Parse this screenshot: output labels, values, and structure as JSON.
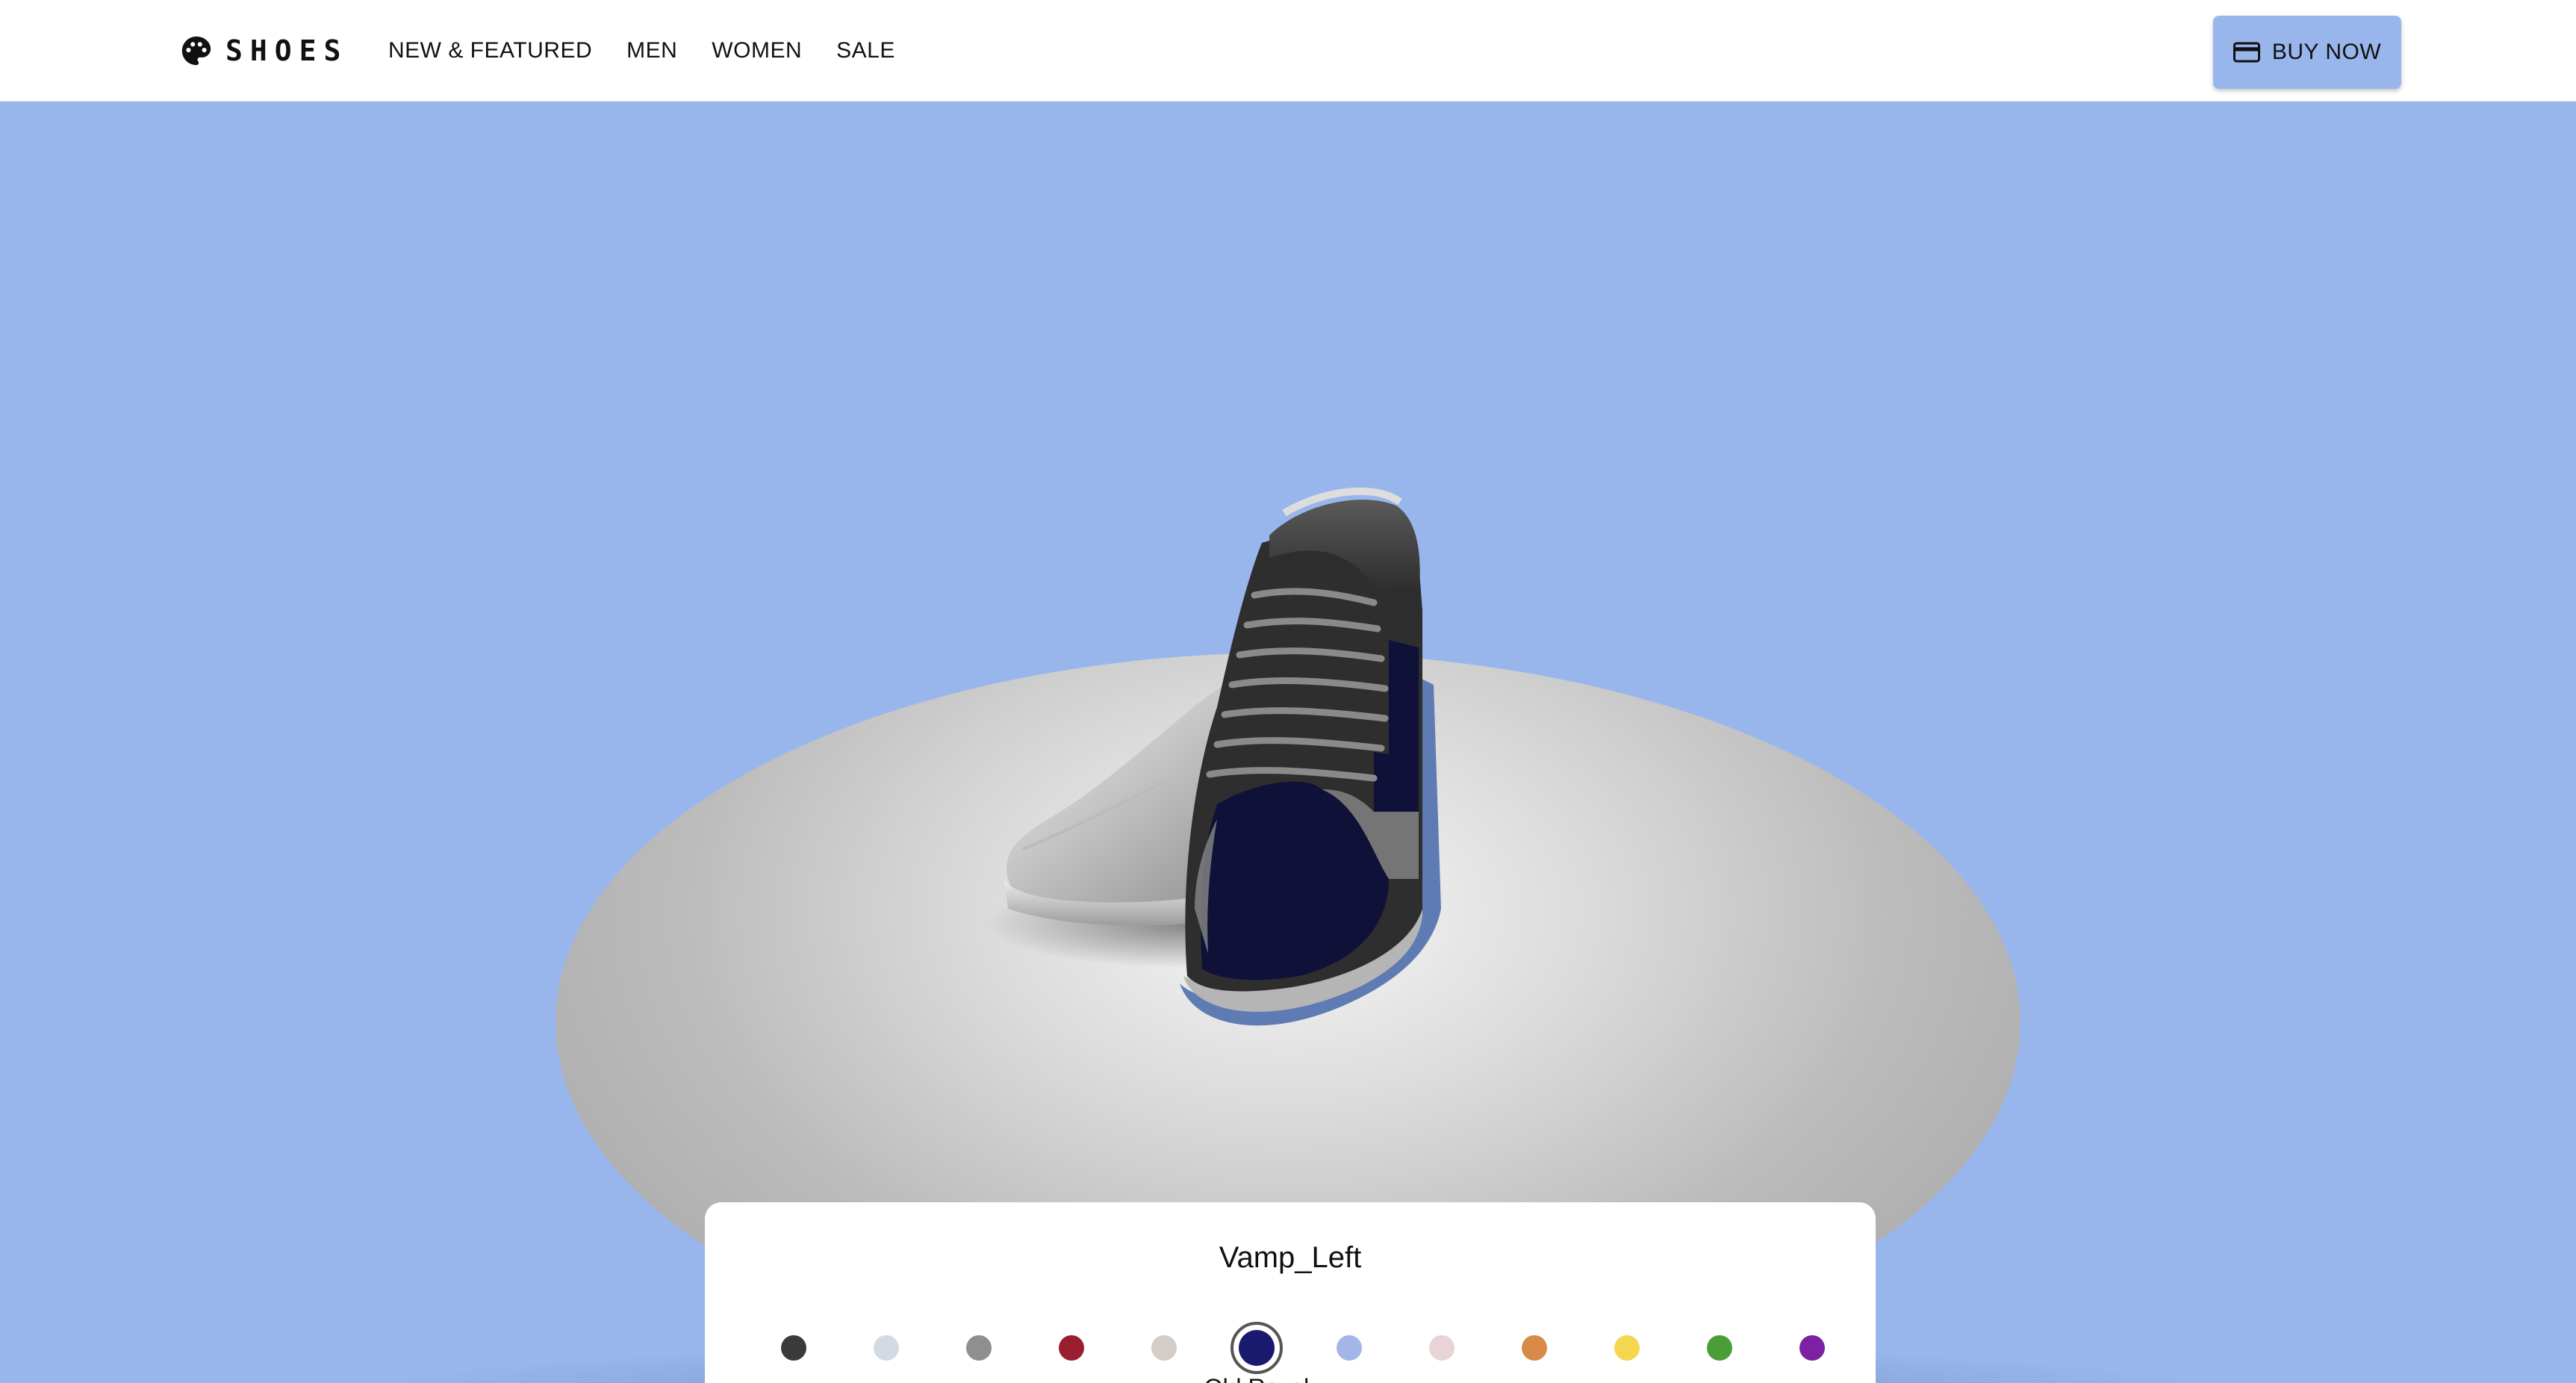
{
  "brand": {
    "name": "SHOES",
    "icon": "palette-icon"
  },
  "nav": {
    "items": [
      {
        "label": "NEW & FEATURED"
      },
      {
        "label": "MEN"
      },
      {
        "label": "WOMEN"
      },
      {
        "label": "SALE"
      }
    ]
  },
  "header": {
    "buy_label": "BUY NOW",
    "buy_icon": "credit-card-icon"
  },
  "colors": {
    "background": "#98b6ec",
    "accent": "#98b6ec",
    "platform": "#bdbdbd"
  },
  "customizer": {
    "part": "Vamp_Left",
    "selected_label": "Old Royal",
    "swatches": [
      {
        "color": "#3a3a3a"
      },
      {
        "color": "#d4dae3"
      },
      {
        "color": "#8f8f8f"
      },
      {
        "color": "#9a1f2e"
      },
      {
        "color": "#d3cdc6"
      },
      {
        "color": "#1a1a6e",
        "selected": true
      },
      {
        "color": "#a3b6e6"
      },
      {
        "color": "#e8d3d6"
      },
      {
        "color": "#d78b46"
      },
      {
        "color": "#f5d74f"
      },
      {
        "color": "#4a9e37"
      },
      {
        "color": "#7b22a4"
      }
    ]
  }
}
